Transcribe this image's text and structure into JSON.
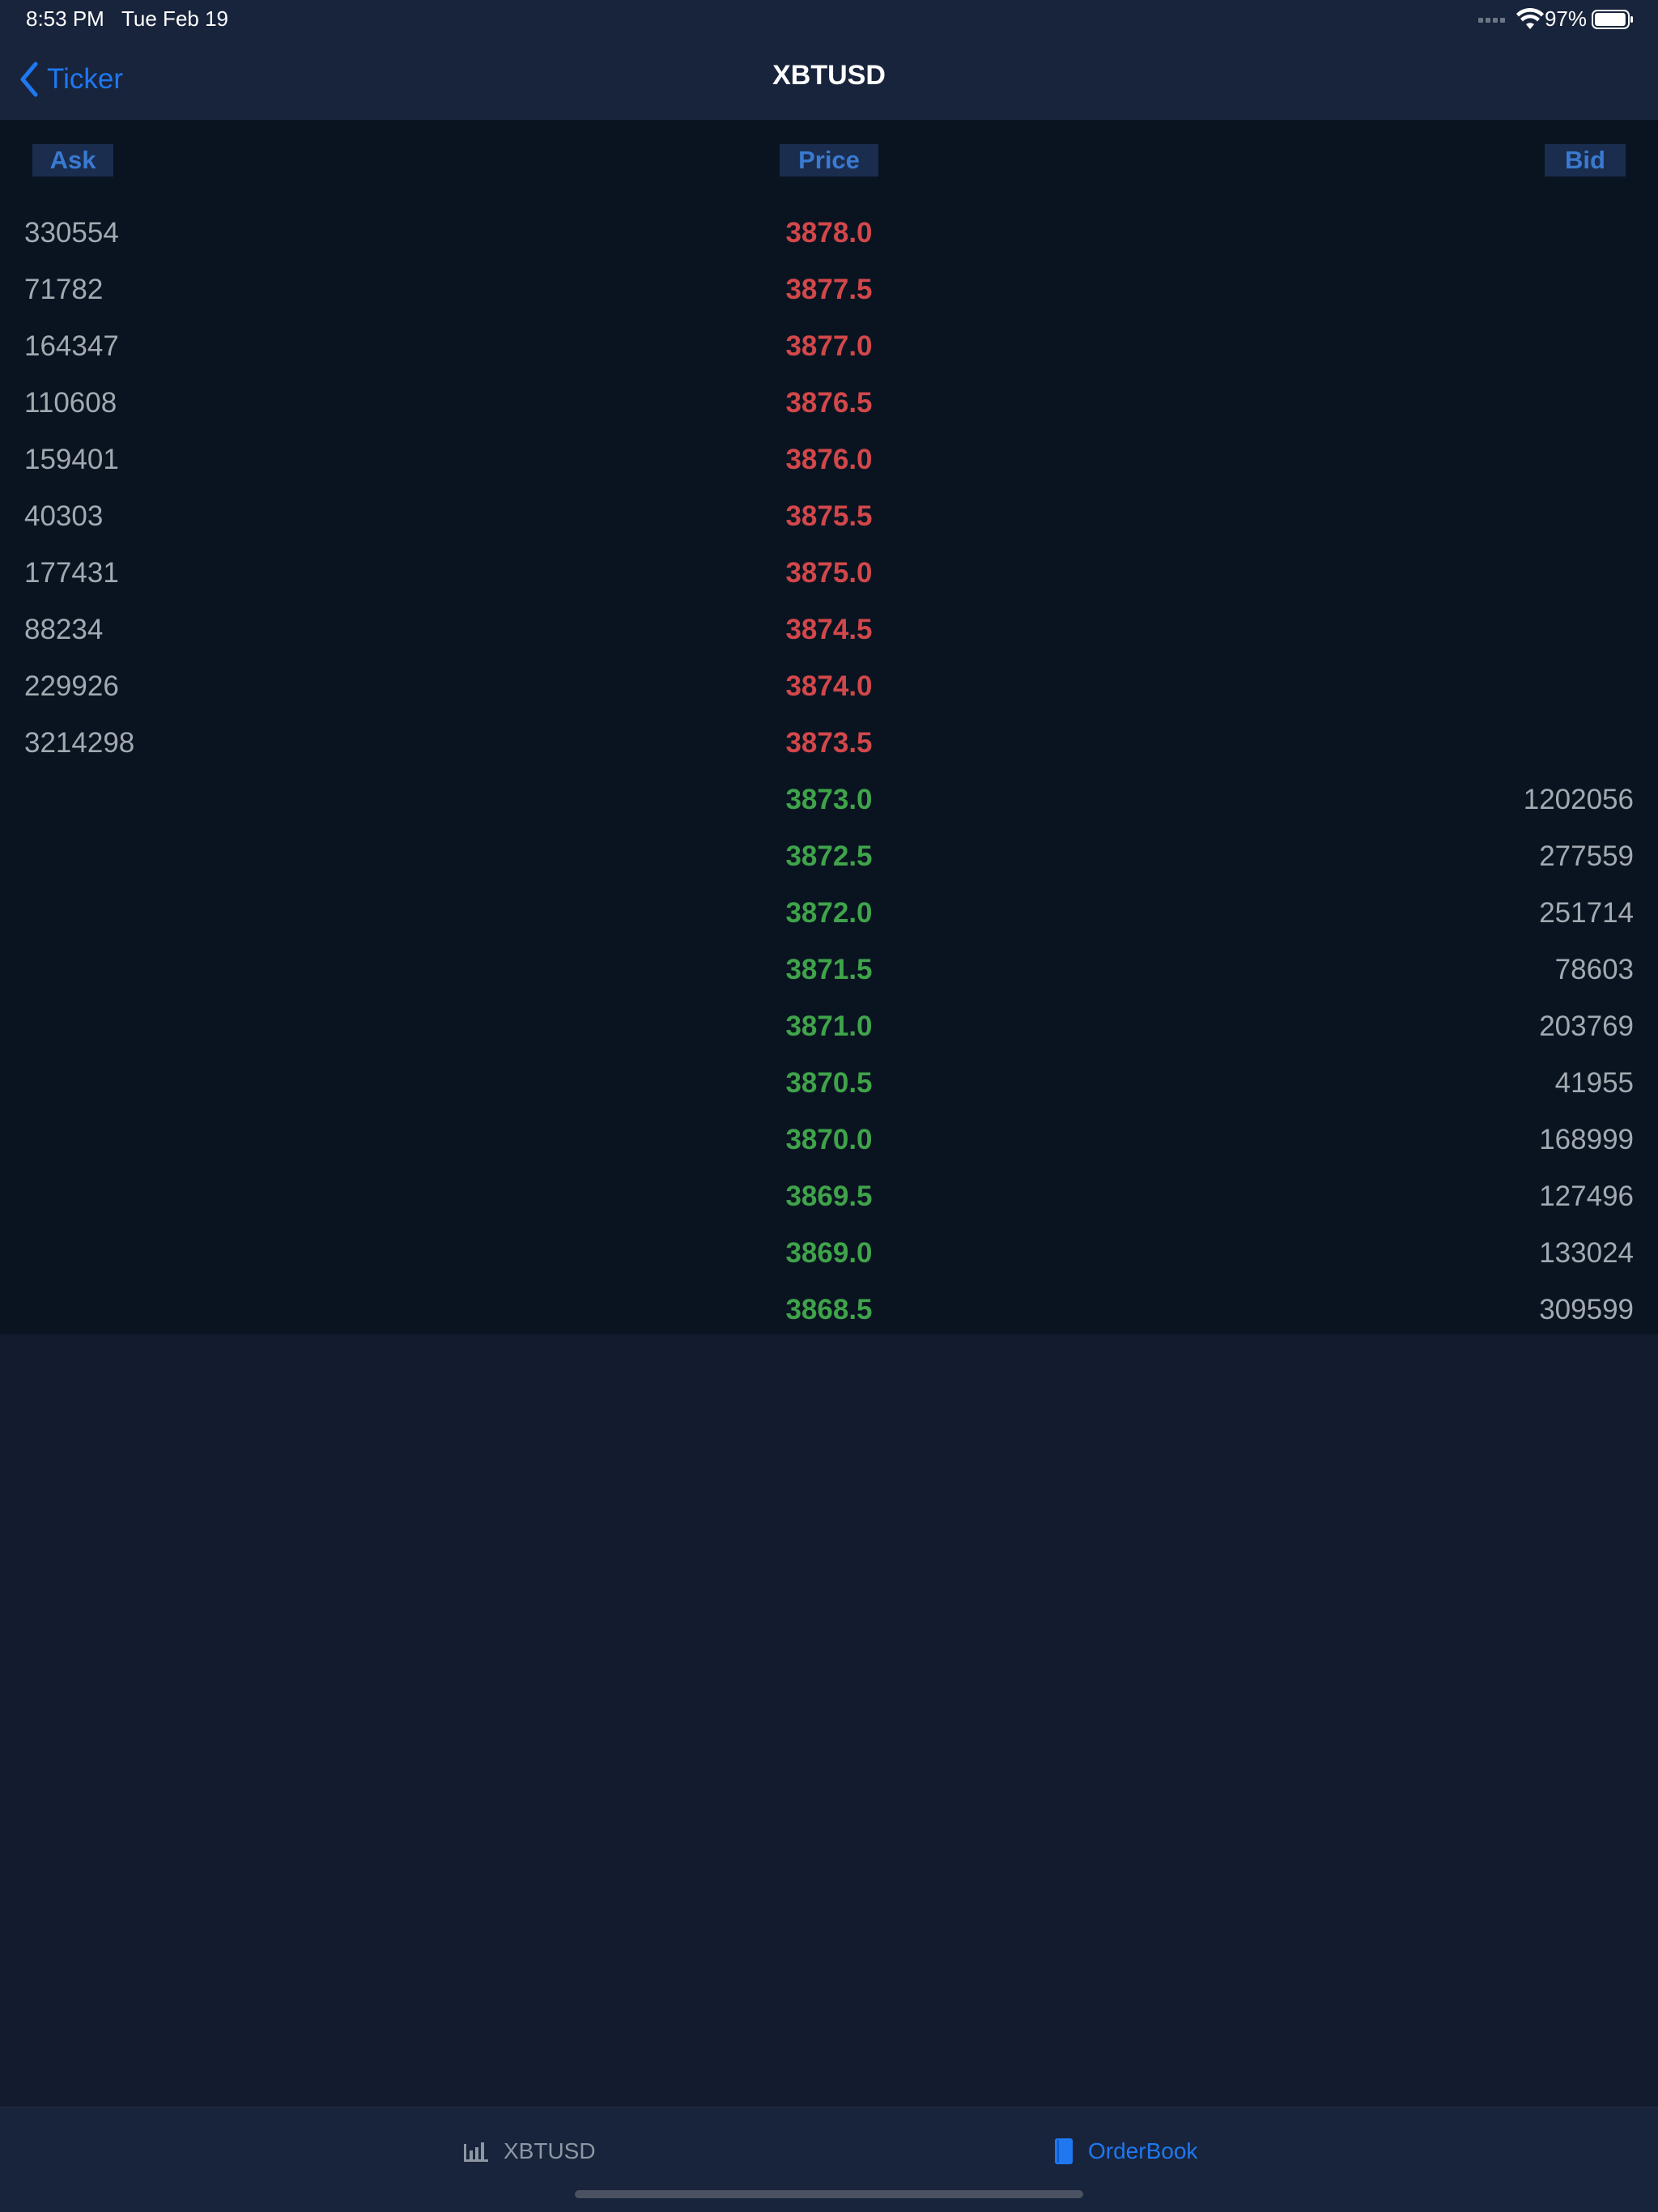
{
  "status": {
    "time": "8:53 PM",
    "date": "Tue Feb 19",
    "battery_pct": "97%",
    "battery_level": 0.97,
    "icons": [
      "signal-icon",
      "wifi-icon",
      "battery-icon"
    ]
  },
  "nav": {
    "back_label": "Ticker",
    "title": "XBTUSD"
  },
  "headers": {
    "ask": "Ask",
    "price": "Price",
    "bid": "Bid"
  },
  "colors": {
    "accent": "#1f78f0",
    "ask_price": "#d2474a",
    "bid_price": "#3fa34a",
    "background": "#131c2e",
    "book_background": "#0a1421"
  },
  "asks": [
    {
      "qty": "330554",
      "price": "3878.0"
    },
    {
      "qty": "71782",
      "price": "3877.5"
    },
    {
      "qty": "164347",
      "price": "3877.0"
    },
    {
      "qty": "110608",
      "price": "3876.5"
    },
    {
      "qty": "159401",
      "price": "3876.0"
    },
    {
      "qty": "40303",
      "price": "3875.5"
    },
    {
      "qty": "177431",
      "price": "3875.0"
    },
    {
      "qty": "88234",
      "price": "3874.5"
    },
    {
      "qty": "229926",
      "price": "3874.0"
    },
    {
      "qty": "3214298",
      "price": "3873.5"
    }
  ],
  "bids": [
    {
      "price": "3873.0",
      "qty": "1202056"
    },
    {
      "price": "3872.5",
      "qty": "277559"
    },
    {
      "price": "3872.0",
      "qty": "251714"
    },
    {
      "price": "3871.5",
      "qty": "78603"
    },
    {
      "price": "3871.0",
      "qty": "203769"
    },
    {
      "price": "3870.5",
      "qty": "41955"
    },
    {
      "price": "3870.0",
      "qty": "168999"
    },
    {
      "price": "3869.5",
      "qty": "127496"
    },
    {
      "price": "3869.0",
      "qty": "133024"
    },
    {
      "price": "3868.5",
      "qty": "309599"
    }
  ],
  "tabs": [
    {
      "label": "XBTUSD",
      "icon": "bar-chart-icon",
      "selected": false
    },
    {
      "label": "OrderBook",
      "icon": "book-icon",
      "selected": true
    }
  ]
}
